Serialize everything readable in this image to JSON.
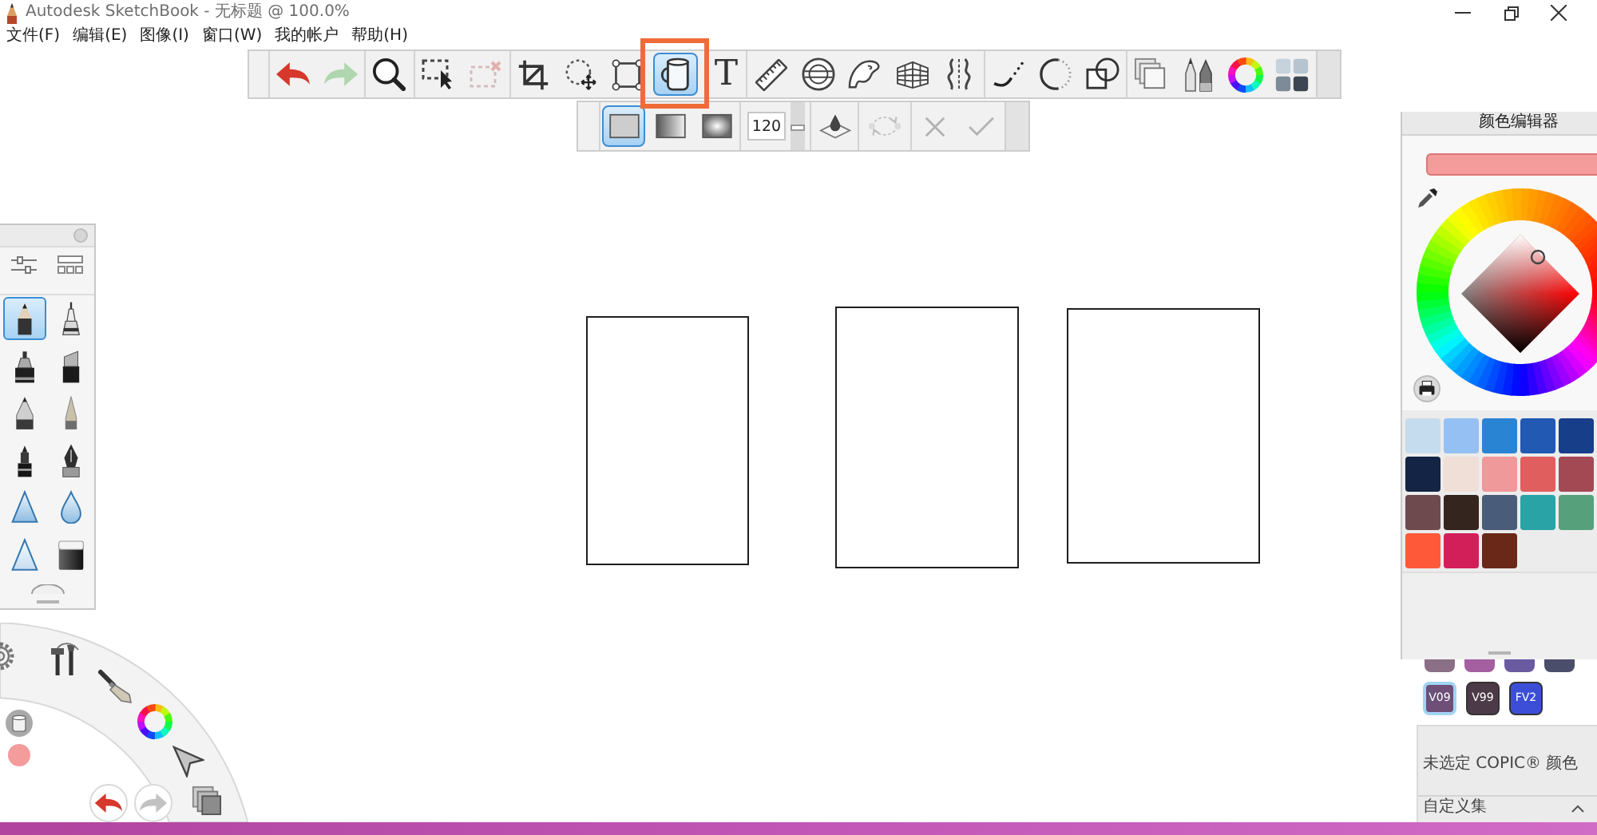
{
  "window": {
    "title": "Autodesk SketchBook - 无标题 @ 100.0%"
  },
  "menu": [
    {
      "label": "文件(F)"
    },
    {
      "label": "编辑(E)"
    },
    {
      "label": "图像(I)"
    },
    {
      "label": "窗口(W)"
    },
    {
      "label": "我的帐户"
    },
    {
      "label": "帮助(H)"
    }
  ],
  "main_toolbar": {
    "groups": [
      {
        "tools": [
          {
            "kind": "undo",
            "selected": false,
            "disabled": false,
            "annotated": false
          },
          {
            "kind": "redo",
            "selected": false,
            "disabled": true,
            "annotated": false
          }
        ]
      },
      {
        "tools": [
          {
            "kind": "zoom",
            "selected": false,
            "disabled": false,
            "annotated": false
          }
        ]
      },
      {
        "tools": [
          {
            "kind": "select",
            "selected": false,
            "disabled": false,
            "annotated": false
          },
          {
            "kind": "deselect",
            "selected": false,
            "disabled": true,
            "annotated": false
          }
        ]
      },
      {
        "tools": [
          {
            "kind": "crop",
            "selected": false,
            "disabled": false,
            "annotated": false
          },
          {
            "kind": "transform",
            "selected": false,
            "disabled": false,
            "annotated": false
          },
          {
            "kind": "distort",
            "selected": false,
            "disabled": false,
            "annotated": false
          },
          {
            "kind": "fill",
            "selected": true,
            "disabled": false,
            "annotated": true
          },
          {
            "kind": "text",
            "glyph": "T",
            "selected": false,
            "disabled": false,
            "annotated": false
          }
        ]
      },
      {
        "tools": [
          {
            "kind": "ruler",
            "selected": false,
            "disabled": false,
            "annotated": false
          },
          {
            "kind": "ellipse_guide",
            "selected": false,
            "disabled": false,
            "annotated": false
          },
          {
            "kind": "french_curve",
            "selected": false,
            "disabled": false,
            "annotated": false
          },
          {
            "kind": "perspective",
            "selected": false,
            "disabled": false,
            "annotated": false
          },
          {
            "kind": "symmetry",
            "selected": false,
            "disabled": false,
            "annotated": false
          }
        ]
      },
      {
        "tools": [
          {
            "kind": "stroke",
            "selected": false,
            "disabled": false,
            "annotated": false
          },
          {
            "kind": "circle",
            "selected": false,
            "disabled": false,
            "annotated": false
          },
          {
            "kind": "shapes",
            "selected": false,
            "disabled": false,
            "annotated": false
          }
        ]
      },
      {
        "tools": [
          {
            "kind": "layers",
            "selected": false,
            "disabled": false,
            "annotated": false
          },
          {
            "kind": "brush_library",
            "selected": false,
            "disabled": false,
            "annotated": false
          },
          {
            "kind": "color_wheel",
            "selected": false,
            "disabled": false,
            "annotated": false
          },
          {
            "kind": "copic_library",
            "selected": false,
            "disabled": false,
            "annotated": false
          }
        ]
      }
    ]
  },
  "fill_toolbar": {
    "modes": [
      {
        "kind": "solid",
        "selected": true
      },
      {
        "kind": "linear",
        "selected": false
      },
      {
        "kind": "radial",
        "selected": false
      }
    ],
    "tolerance": {
      "value": "120",
      "level": 0.47
    },
    "actions": [
      {
        "tools": [
          {
            "kind": "sample_layers",
            "disabled": false
          }
        ]
      },
      {
        "tools": [
          {
            "kind": "swap",
            "disabled": true
          }
        ]
      },
      {
        "tools": [
          {
            "kind": "cancel",
            "disabled": true
          },
          {
            "kind": "confirm",
            "disabled": true
          }
        ]
      }
    ]
  },
  "brush_palette": {
    "header_tools": [
      {
        "kind": "sliders"
      },
      {
        "kind": "layout"
      }
    ],
    "brushes": [
      {
        "kind": "pencil",
        "selected": true
      },
      {
        "kind": "technical_pen",
        "selected": false
      },
      {
        "kind": "marker",
        "selected": false
      },
      {
        "kind": "chisel_marker",
        "selected": false
      },
      {
        "kind": "ballpoint",
        "selected": false
      },
      {
        "kind": "paintbrush",
        "selected": false
      },
      {
        "kind": "felt_pen",
        "selected": false
      },
      {
        "kind": "fountain_pen",
        "selected": false
      },
      {
        "kind": "hard_airbrush",
        "selected": false
      },
      {
        "kind": "soft_airbrush",
        "selected": false
      },
      {
        "kind": "airbrush",
        "selected": false
      },
      {
        "kind": "eraser",
        "selected": false
      }
    ]
  },
  "canvas": {
    "shapes": [
      {
        "kind": "rectangle"
      },
      {
        "kind": "rectangle"
      },
      {
        "kind": "rectangle"
      }
    ]
  },
  "color_editor": {
    "title": "颜色编辑器",
    "current": {
      "color": "#f49b9b"
    },
    "swatches": [
      {
        "color": "#c5dcee"
      },
      {
        "color": "#94c0f4"
      },
      {
        "color": "#2a84d4"
      },
      {
        "color": "#2159b3"
      },
      {
        "color": "#173e89"
      },
      {
        "color": "#142444"
      },
      {
        "color": "#efdfd6"
      },
      {
        "color": "#f0999a"
      },
      {
        "color": "#e05e5e"
      },
      {
        "color": "#a34954"
      },
      {
        "color": "#6e4a4e"
      },
      {
        "color": "#35251f"
      },
      {
        "color": "#495d7b"
      },
      {
        "color": "#2aa3a6"
      },
      {
        "color": "#56a07b"
      },
      {
        "color": "#fe5a3a"
      },
      {
        "color": "#d21f5a"
      },
      {
        "color": "#6a2818"
      }
    ]
  },
  "copic_panel": {
    "partial_swatches": [
      {
        "color": "#8b6f86"
      },
      {
        "color": "#a45fa0"
      },
      {
        "color": "#6a5aa0"
      },
      {
        "color": "#4a4e6a"
      }
    ],
    "swatches": [
      {
        "label": "V09",
        "color": "#6d4f78",
        "highlighted": true
      },
      {
        "label": "V99",
        "color": "#4d3a48",
        "highlighted": false
      },
      {
        "label": "FV2",
        "color": "#3c4ed8",
        "highlighted": false
      }
    ],
    "status": "未选定 COPIC® 颜色",
    "section": "自定义集"
  },
  "lagoon": {
    "ring_tools": [
      {
        "kind": "settings"
      },
      {
        "kind": "tools"
      },
      {
        "kind": "brush"
      },
      {
        "kind": "color"
      },
      {
        "kind": "select"
      },
      {
        "kind": "layers"
      }
    ],
    "history": [
      {
        "kind": "undo",
        "disabled": false
      },
      {
        "kind": "redo",
        "disabled": true
      }
    ],
    "puck": {
      "color": "#f49b9b"
    }
  }
}
